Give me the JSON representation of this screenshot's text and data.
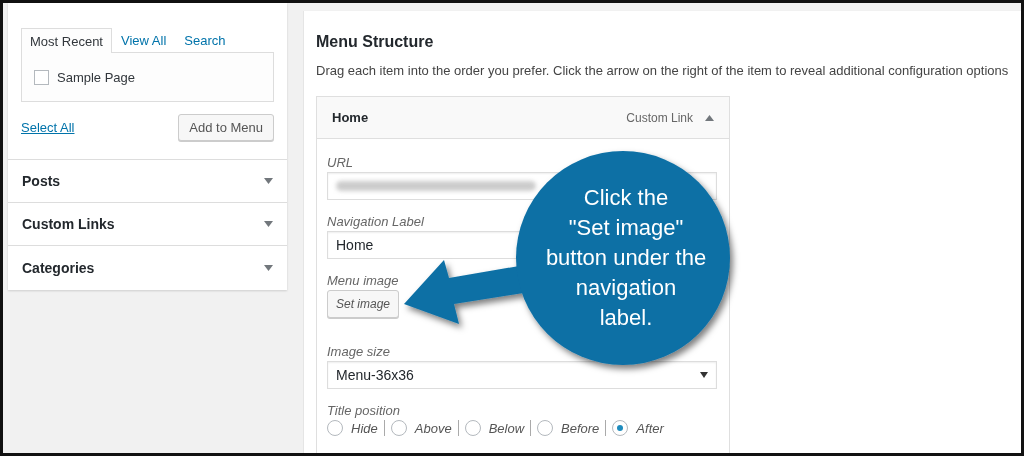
{
  "sidebar": {
    "tabs": [
      {
        "label": "Most Recent",
        "selected": true
      },
      {
        "label": "View All",
        "selected": false
      },
      {
        "label": "Search",
        "selected": false
      }
    ],
    "items": [
      {
        "label": "Sample Page",
        "checked": false
      }
    ],
    "select_all": "Select All",
    "add_button": "Add to Menu",
    "sections": [
      {
        "label": "Posts"
      },
      {
        "label": "Custom Links"
      },
      {
        "label": "Categories"
      }
    ]
  },
  "main": {
    "title": "Menu Structure",
    "description": "Drag each item into the order you prefer. Click the arrow on the right of the item to reveal additional configuration options",
    "item": {
      "title": "Home",
      "type": "Custom Link",
      "expanded": true,
      "url_label": "URL",
      "nav_label": "Navigation Label",
      "nav_value": "Home",
      "image_label": "Menu image",
      "set_image": "Set image",
      "size_label": "Image size",
      "size_value": "Menu-36x36",
      "position_label": "Title position",
      "positions": [
        {
          "label": "Hide",
          "selected": false
        },
        {
          "label": "Above",
          "selected": false
        },
        {
          "label": "Below",
          "selected": false
        },
        {
          "label": "Before",
          "selected": false
        },
        {
          "label": "After",
          "selected": true
        }
      ]
    }
  },
  "callout": {
    "lines": [
      "Click the",
      "\"Set image\"",
      "button under the",
      "navigation",
      "label."
    ]
  }
}
